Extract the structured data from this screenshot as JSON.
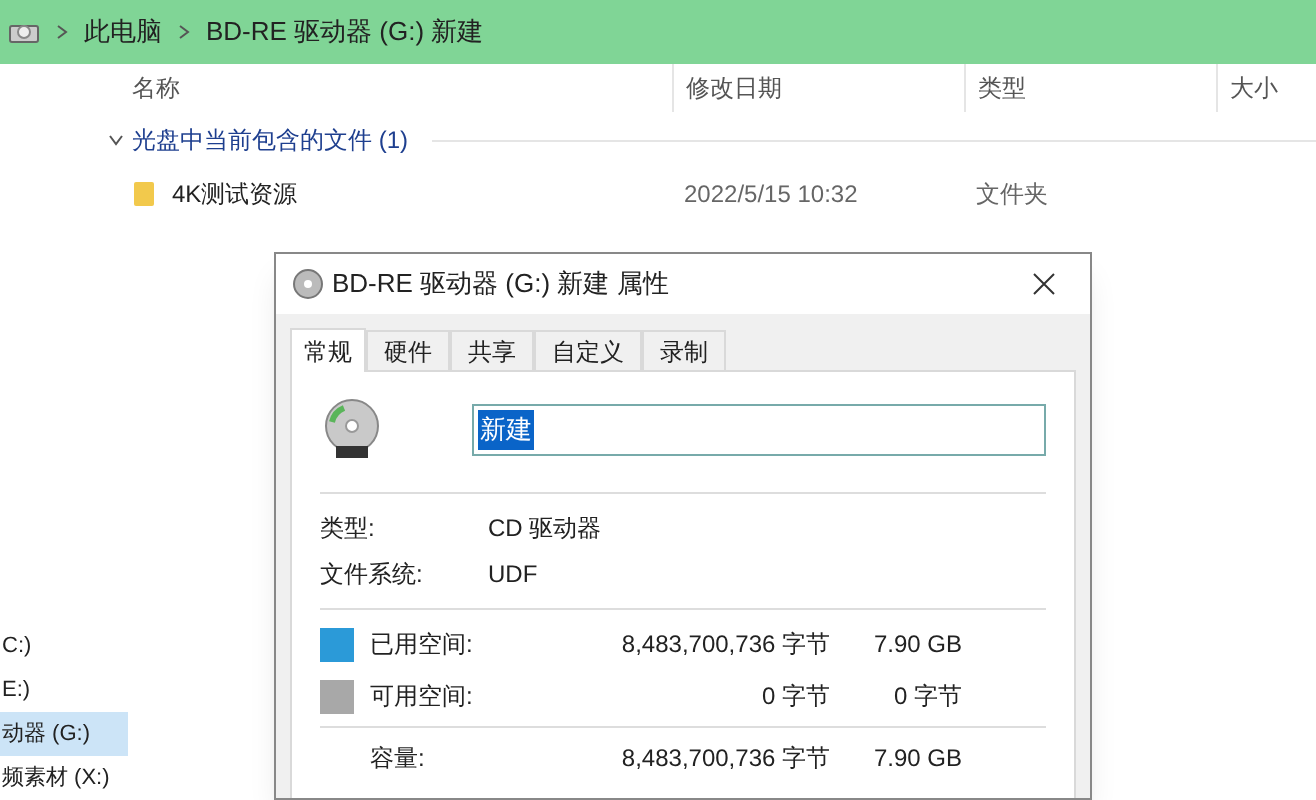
{
  "address_bar": {
    "crumbs": [
      "此电脑",
      "BD-RE 驱动器 (G:) 新建"
    ]
  },
  "columns": [
    "名称",
    "修改日期",
    "类型",
    "大小"
  ],
  "group": {
    "label": "光盘中当前包含的文件 (1)",
    "expanded": true
  },
  "files": [
    {
      "name": "4K测试资源",
      "date": "2022/5/15 10:32",
      "type": "文件夹"
    }
  ],
  "sidebar": {
    "items": [
      {
        "label": "C:)",
        "selected": false
      },
      {
        "label": "E:)",
        "selected": false
      },
      {
        "label": "动器 (G:)",
        "selected": true
      },
      {
        "label": "频素材 (X:)",
        "selected": false
      }
    ]
  },
  "dialog": {
    "title": "BD-RE 驱动器 (G:) 新建 属性",
    "tabs": [
      {
        "label": "常规",
        "selected": true
      },
      {
        "label": "硬件",
        "selected": false
      },
      {
        "label": "共享",
        "selected": false
      },
      {
        "label": "自定义",
        "selected": false
      },
      {
        "label": "录制",
        "selected": false
      }
    ],
    "name_value": "新建",
    "info": [
      {
        "label": "类型:",
        "value": "CD 驱动器"
      },
      {
        "label": "文件系统:",
        "value": "UDF"
      }
    ],
    "space": [
      {
        "label": "已用空间:",
        "bytes": "8,483,700,736 字节",
        "size": "7.90 GB",
        "color": "#2b9ad8"
      },
      {
        "label": "可用空间:",
        "bytes": "0 字节",
        "size": "0 字节",
        "color": "#a8a8a8"
      }
    ],
    "capacity": {
      "label": "容量:",
      "bytes": "8,483,700,736 字节",
      "size": "7.90 GB"
    }
  }
}
